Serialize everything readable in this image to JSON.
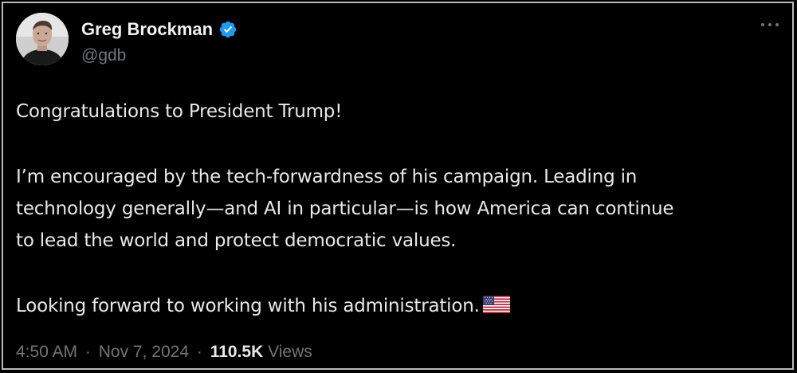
{
  "author": {
    "display_name": "Greg Brockman",
    "handle": "@gdb",
    "verified": true,
    "verified_color": "#1d9bf0"
  },
  "tweet": {
    "lines": [
      "Congratulations to President Trump!",
      "I’m encouraged by the tech-forwardness of his campaign. Leading in",
      "technology generally—and AI in particular—is how America can continue",
      "to lead the world and protect democratic values.",
      "Looking forward to working with his administration."
    ],
    "emoji": "us-flag-icon"
  },
  "meta": {
    "time": "4:50 AM",
    "separator": "·",
    "date": "Nov 7, 2024",
    "views_count": "110.5K",
    "views_label": "Views"
  },
  "theme": {
    "background": "#000000",
    "text": "#e7e9ea",
    "secondary_text": "#71767b",
    "border": "#b9b9b9"
  }
}
